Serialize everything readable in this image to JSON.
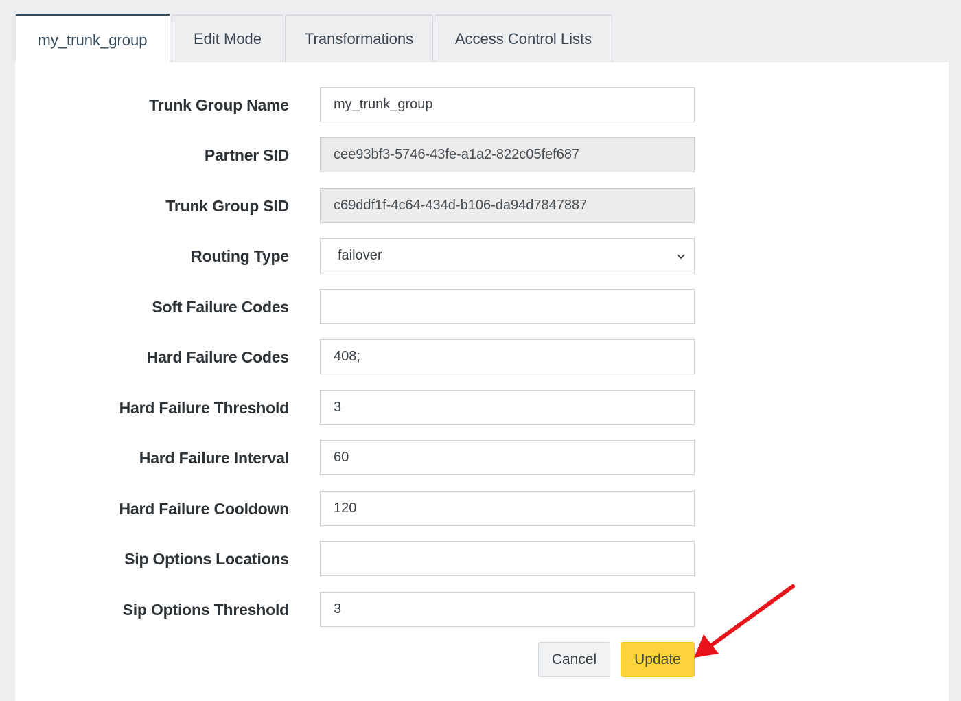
{
  "tabs": [
    {
      "label": "my_trunk_group",
      "active": true
    },
    {
      "label": "Edit Mode",
      "active": false
    },
    {
      "label": "Transformations",
      "active": false
    },
    {
      "label": "Access Control Lists",
      "active": false
    }
  ],
  "form": {
    "trunk_group_name": {
      "label": "Trunk Group Name",
      "value": "my_trunk_group"
    },
    "partner_sid": {
      "label": "Partner SID",
      "value": "cee93bf3-5746-43fe-a1a2-822c05fef687"
    },
    "trunk_group_sid": {
      "label": "Trunk Group SID",
      "value": "c69ddf1f-4c64-434d-b106-da94d7847887"
    },
    "routing_type": {
      "label": "Routing Type",
      "value": "failover"
    },
    "soft_failure_codes": {
      "label": "Soft Failure Codes",
      "value": ""
    },
    "hard_failure_codes": {
      "label": "Hard Failure Codes",
      "value": "408;"
    },
    "hard_failure_threshold": {
      "label": "Hard Failure Threshold",
      "value": "3"
    },
    "hard_failure_interval": {
      "label": "Hard Failure Interval",
      "value": "60"
    },
    "hard_failure_cooldown": {
      "label": "Hard Failure Cooldown",
      "value": "120"
    },
    "sip_options_locations": {
      "label": "Sip Options Locations",
      "value": ""
    },
    "sip_options_threshold": {
      "label": "Sip Options Threshold",
      "value": "3"
    }
  },
  "buttons": {
    "cancel_label": "Cancel",
    "update_label": "Update"
  },
  "colors": {
    "accent_tab": "#34495a",
    "update_button": "#fdd33a",
    "annotation_arrow": "#e8141c"
  },
  "icons": {
    "routing_dropdown": "chevron-down-icon",
    "annotation": "red-arrow-icon"
  }
}
